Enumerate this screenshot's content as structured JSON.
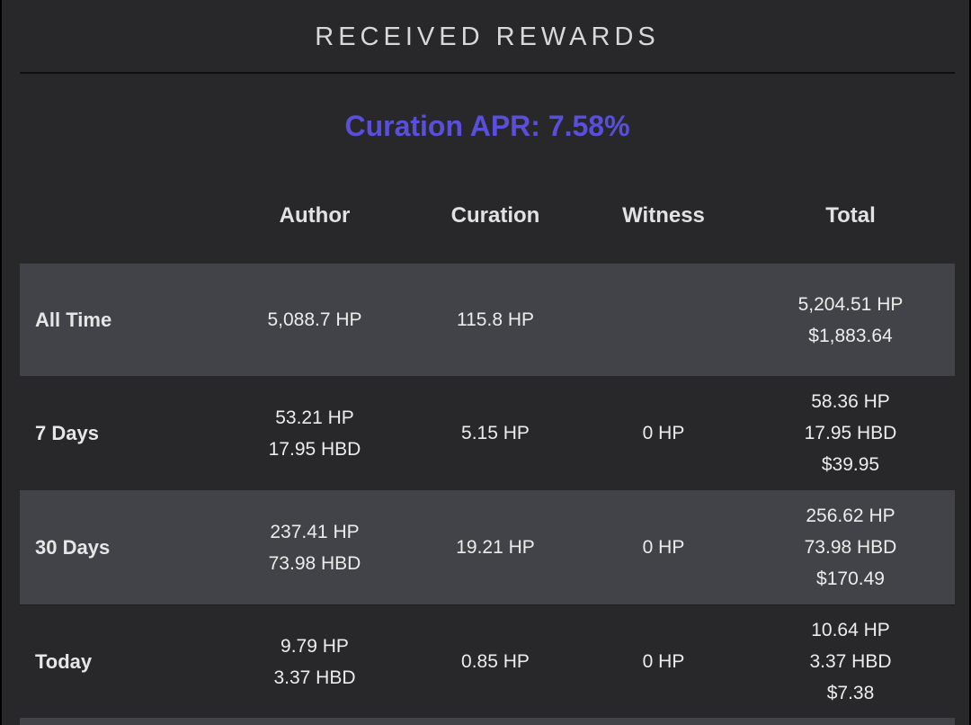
{
  "header": {
    "title": "RECEIVED REWARDS"
  },
  "apr": {
    "text": "Curation APR: 7.58%",
    "color": "#5a4fdc"
  },
  "columns": [
    "Author",
    "Curation",
    "Witness",
    "Total"
  ],
  "rows": [
    {
      "label": "All Time",
      "author": [
        "5,088.7 HP"
      ],
      "curation": [
        "115.8 HP"
      ],
      "witness": [],
      "total": [
        "5,204.51 HP",
        "$1,883.64"
      ]
    },
    {
      "label": "7 Days",
      "author": [
        "53.21 HP",
        "17.95 HBD"
      ],
      "curation": [
        "5.15 HP"
      ],
      "witness": [
        "0 HP"
      ],
      "total": [
        "58.36 HP",
        "17.95 HBD",
        "$39.95"
      ]
    },
    {
      "label": "30 Days",
      "author": [
        "237.41 HP",
        "73.98 HBD"
      ],
      "curation": [
        "19.21 HP"
      ],
      "witness": [
        "0 HP"
      ],
      "total": [
        "256.62 HP",
        "73.98 HBD",
        "$170.49"
      ]
    },
    {
      "label": "Today",
      "author": [
        "9.79 HP",
        "3.37 HBD"
      ],
      "curation": [
        "0.85 HP"
      ],
      "witness": [
        "0 HP"
      ],
      "total": [
        "10.64 HP",
        "3.37 HBD",
        "$7.38"
      ]
    }
  ]
}
